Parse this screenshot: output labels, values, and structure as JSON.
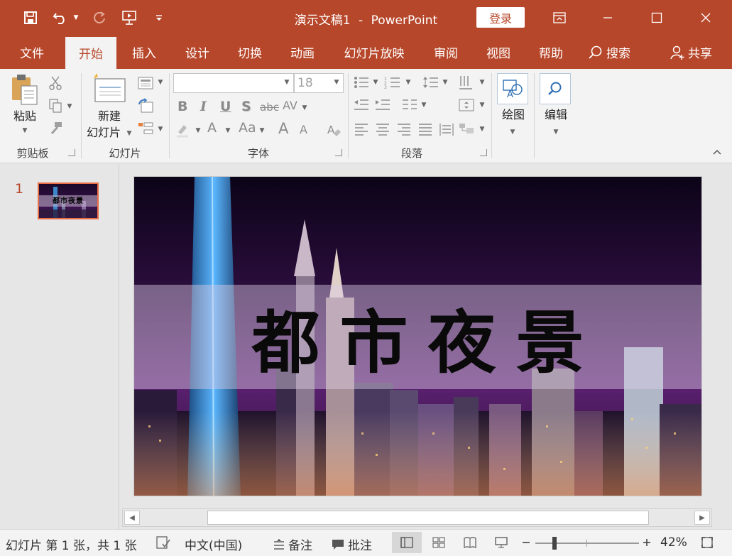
{
  "titlebar": {
    "document": "演示文稿1",
    "separator": "-",
    "app": "PowerPoint",
    "login": "登录",
    "icons": [
      "save-icon",
      "undo-icon",
      "redo-icon",
      "present-from-start-icon",
      "customize-qat-icon",
      "ribbon-display-icon",
      "minimize-icon",
      "maximize-icon",
      "close-icon"
    ]
  },
  "tabs": [
    {
      "label": "文件"
    },
    {
      "label": "开始"
    },
    {
      "label": "插入"
    },
    {
      "label": "设计"
    },
    {
      "label": "切换"
    },
    {
      "label": "动画"
    },
    {
      "label": "幻灯片放映"
    },
    {
      "label": "审阅"
    },
    {
      "label": "视图"
    },
    {
      "label": "帮助"
    }
  ],
  "tab_active": "开始",
  "search_label": "搜索",
  "share_label": "共享",
  "ribbon": {
    "clipboard": {
      "paste": "粘贴",
      "group": "剪贴板"
    },
    "slides": {
      "new_line1": "新建",
      "new_line2": "幻灯片",
      "group": "幻灯片"
    },
    "font": {
      "font_name": "",
      "font_size": "18",
      "group": "字体",
      "bold": "B",
      "italic": "I",
      "underline": "U",
      "shadow": "S",
      "strike": "abc",
      "spacing": "AV",
      "color": "A",
      "case": "Aa",
      "grow": "A",
      "shrink": "A"
    },
    "paragraph": {
      "group": "段落"
    },
    "drawing": {
      "label": "绘图"
    },
    "editing": {
      "label": "编辑"
    }
  },
  "slide_pane": {
    "number": "1",
    "thumb_title": "都市夜景"
  },
  "slide": {
    "title": "都市夜景"
  },
  "status": {
    "slide_info": "幻灯片 第 1 张，共 1 张",
    "language": "中文(中国)",
    "notes": "备注",
    "comments": "批注",
    "zoom": "42%"
  },
  "colors": {
    "accent": "#b7472a",
    "ribbon_bg": "#f3f3f3",
    "thumb_border": "#e86c44"
  }
}
